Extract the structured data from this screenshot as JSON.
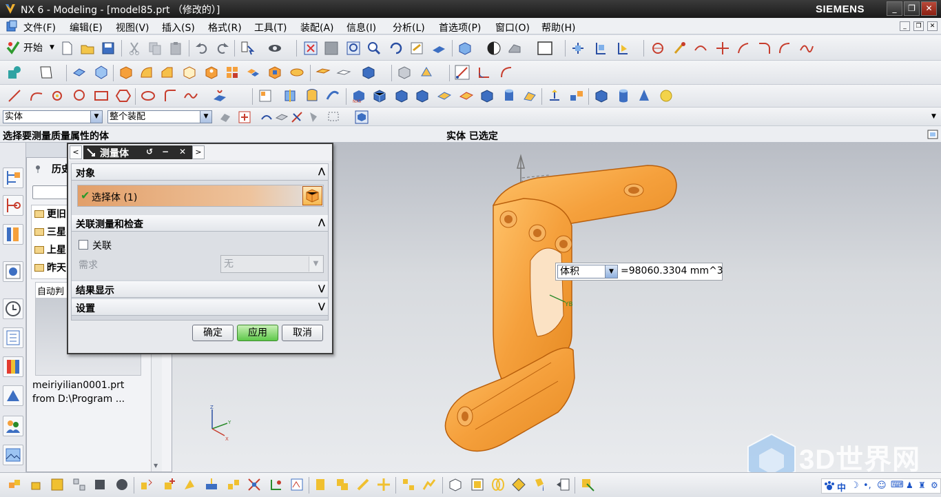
{
  "window": {
    "title": "NX 6 - Modeling - [model85.prt （修改的）]",
    "brand": "SIEMENS",
    "controls": [
      "_",
      "❐",
      "✕"
    ]
  },
  "menubar": {
    "items": [
      "文件(F)",
      "编辑(E)",
      "视图(V)",
      "插入(S)",
      "格式(R)",
      "工具(T)",
      "装配(A)",
      "信息(I)",
      "分析(L)",
      "首选项(P)",
      "窗口(O)",
      "帮助(H)"
    ]
  },
  "toolbar": {
    "start_label": "开始",
    "filter_type": "实体",
    "filter_scope": "整个装配"
  },
  "cue": {
    "prompt": "选择要测量质量属性的体",
    "status": "实体  已选定"
  },
  "navigator": {
    "tab_label": "历史",
    "rows": [
      "更旧",
      "三星",
      "上星",
      "昨天"
    ],
    "preview_header": "自动判",
    "file_name": "meiriyilian0001.prt",
    "file_from": "from D:\\Program ..."
  },
  "dialog": {
    "title": "测量体",
    "groups": {
      "object": "对象",
      "select_body": "选择体 (1)",
      "associative": "关联测量和检查",
      "associate_label": "关联",
      "requirement_label": "需求",
      "requirement_value": "无",
      "results": "结果显示",
      "settings": "设置"
    },
    "buttons": {
      "ok": "确定",
      "apply": "应用",
      "cancel": "取消"
    }
  },
  "measurement": {
    "type": "体积",
    "value": "=98060.3304 mm^3"
  },
  "triad_labels": {
    "x": "X",
    "y": "Y",
    "z": "Z"
  },
  "watermark": "3D世界网",
  "ime": {
    "label": "中"
  },
  "colors": {
    "part_fill": "#f5a03c",
    "part_edge": "#b95f0c",
    "apply_button": "#5ec84a",
    "check_mark": "#2a9a2a"
  }
}
